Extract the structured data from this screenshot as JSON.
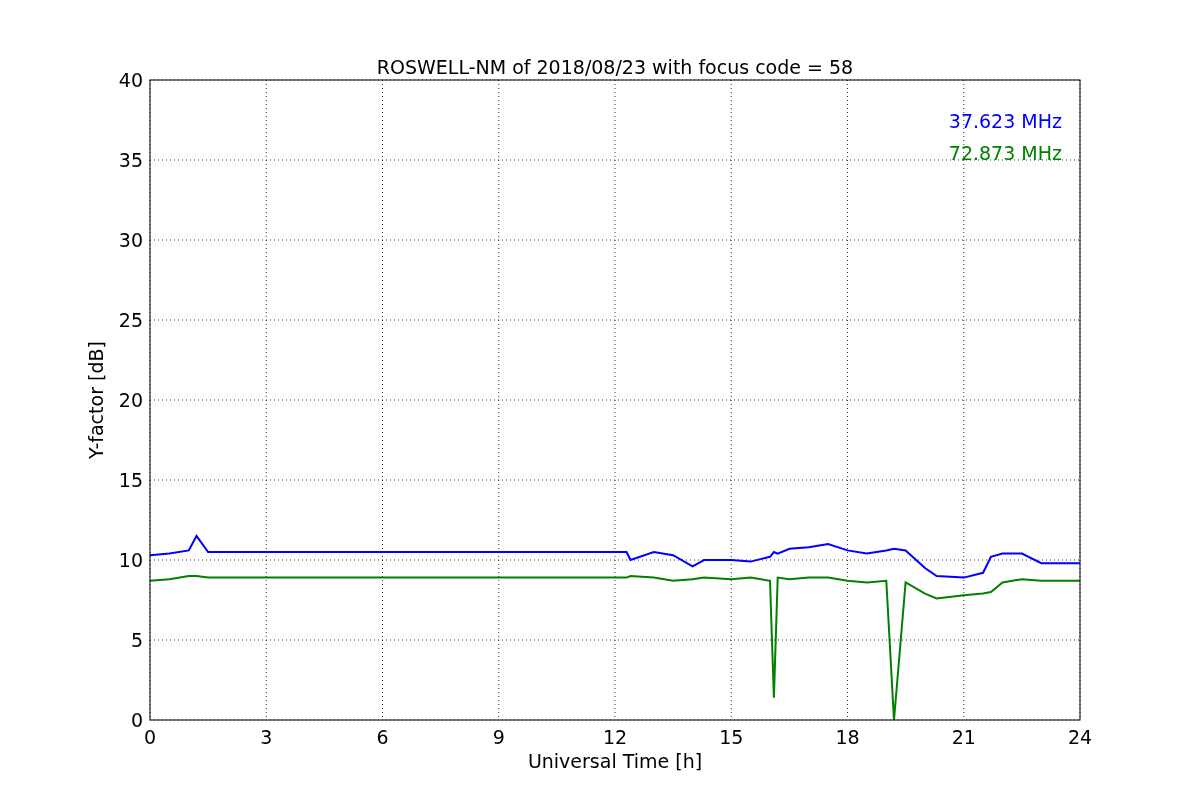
{
  "chart_data": {
    "type": "line",
    "title": "ROSWELL-NM of 2018/08/23 with focus code = 58",
    "xlabel": "Universal Time [h]",
    "ylabel": "Y-factor [dB]",
    "x": [
      0,
      0.5,
      1,
      1.2,
      1.5,
      3,
      6,
      9,
      12.3,
      12.4,
      13,
      13.5,
      14,
      14.3,
      15,
      15.5,
      16,
      16.1,
      16.2,
      16.5,
      17,
      17.5,
      18,
      18.5,
      19,
      19.2,
      19.5,
      20,
      20.3,
      21,
      21.5,
      21.7,
      22,
      22.5,
      23,
      23.5,
      24
    ],
    "series": [
      {
        "name": "37.623 MHz",
        "color": "#0000ff",
        "values": [
          10.3,
          10.4,
          10.6,
          11.5,
          10.5,
          10.5,
          10.5,
          10.5,
          10.5,
          10.0,
          10.5,
          10.3,
          9.6,
          10.0,
          10.0,
          9.9,
          10.2,
          10.5,
          10.4,
          10.7,
          10.8,
          11.0,
          10.6,
          10.4,
          10.6,
          10.7,
          10.6,
          9.5,
          9.0,
          8.9,
          9.2,
          10.2,
          10.4,
          10.4,
          9.8,
          9.8,
          9.8
        ]
      },
      {
        "name": "72.873 MHz",
        "color": "#008000",
        "values": [
          8.7,
          8.8,
          9.0,
          9.0,
          8.9,
          8.9,
          8.9,
          8.9,
          8.9,
          9.0,
          8.9,
          8.7,
          8.8,
          8.9,
          8.8,
          8.9,
          8.7,
          1.4,
          8.9,
          8.8,
          8.9,
          8.9,
          8.7,
          8.6,
          8.7,
          0,
          8.6,
          7.9,
          7.6,
          7.8,
          7.9,
          8.0,
          8.6,
          8.8,
          8.7,
          8.7,
          8.7
        ]
      }
    ],
    "xlim": [
      0,
      24
    ],
    "ylim": [
      0,
      40
    ],
    "xticks": [
      0,
      3,
      6,
      9,
      12,
      15,
      18,
      21,
      24
    ],
    "yticks": [
      0,
      5,
      10,
      15,
      20,
      25,
      30,
      35,
      40
    ],
    "grid": true
  }
}
